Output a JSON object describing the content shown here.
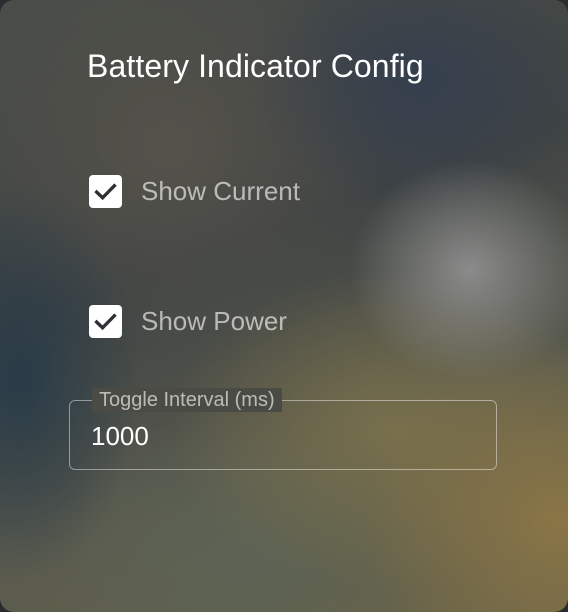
{
  "dialog": {
    "title": "Battery Indicator Config",
    "options": [
      {
        "label": "Show Current",
        "checked": true
      },
      {
        "label": "Show Power",
        "checked": true
      }
    ],
    "interval_field": {
      "label": "Toggle Interval (ms)",
      "value": "1000"
    }
  },
  "icons": {
    "checkbox_checked": "check-icon"
  },
  "colors": {
    "text_primary": "#ffffff",
    "checkbox_fill": "#ffffff",
    "checkmark": "#2f3033"
  }
}
